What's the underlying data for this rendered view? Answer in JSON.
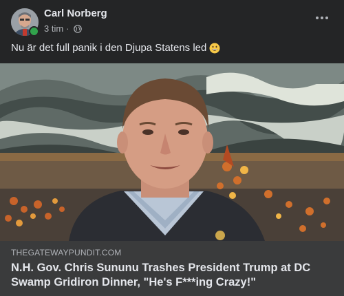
{
  "post": {
    "author": "Carl Norberg",
    "time": "3 tim",
    "separator": "·",
    "audience_icon": "globe-icon",
    "menu_icon": "more-options-icon",
    "text": "Nu är det full panik i den Djupa Statens led",
    "emoji": "grinning-face-emoji",
    "author_online": true
  },
  "link_preview": {
    "domain": "THEGATEWAYPUNDIT.COM",
    "headline": "N.H. Gov. Chris Sununu Trashes President Trump at DC Swamp Gridiron Dinner, \"He's F***ing Crazy!\""
  },
  "colors": {
    "background": "#242526",
    "link_box": "#3a3b3c",
    "primary_text": "#e4e6eb",
    "secondary_text": "#b0b3b8",
    "online": "#31a24c"
  }
}
